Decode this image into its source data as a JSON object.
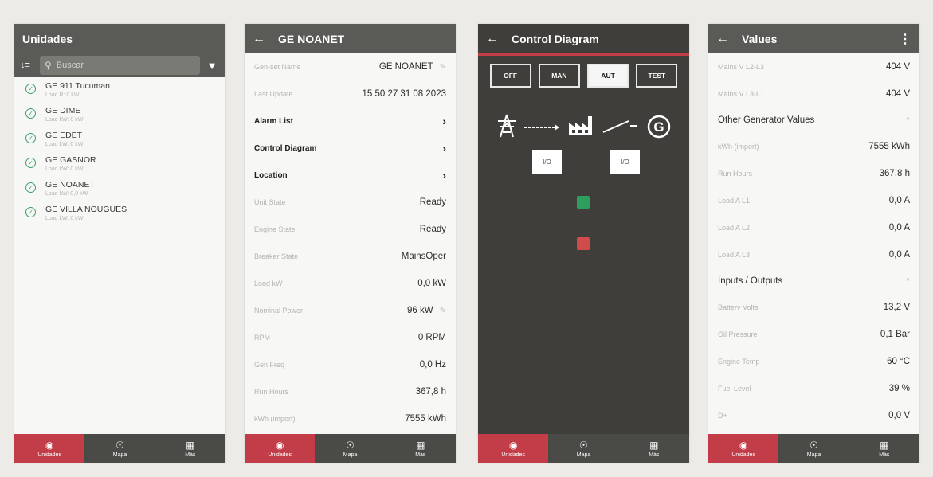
{
  "units_panel": {
    "title": "Unidades",
    "sort_icon": "sort-icon",
    "search_placeholder": "Buscar",
    "items": [
      {
        "name": "GE 911 Tucuman",
        "sub": "Load R: 0 kW"
      },
      {
        "name": "GE DIME",
        "sub": "Load kW: 0 kW"
      },
      {
        "name": "GE EDET",
        "sub": "Load kW: 0 kW"
      },
      {
        "name": "GE GASNOR",
        "sub": "Load kW: 0 kW"
      },
      {
        "name": "GE NOANET",
        "sub": "Load kW: 0,0 kW"
      },
      {
        "name": "GE VILLA NOUGUES",
        "sub": "Load kW: 0 kW"
      }
    ]
  },
  "nav": {
    "units": "Unidades",
    "map": "Mapa",
    "more": "Más"
  },
  "genset_panel": {
    "title": "GE NOANET",
    "genset_name_label": "Gen-set Name",
    "genset_name": "GE NOANET",
    "last_update_label": "Last Update",
    "last_update": "15 50 27 31 08 2023",
    "alarm_list": "Alarm List",
    "control_diagram": "Control Diagram",
    "location": "Location",
    "fields": [
      {
        "label": "Unit State",
        "value": "Ready"
      },
      {
        "label": "Engine State",
        "value": "Ready"
      },
      {
        "label": "Breaker State",
        "value": "MainsOper"
      },
      {
        "label": "Load kW",
        "value": "0,0 kW"
      }
    ],
    "nominal_power_label": "Nominal Power",
    "nominal_power": "96 kW",
    "fields2": [
      {
        "label": "RPM",
        "value": "0 RPM"
      },
      {
        "label": "Gen Freq",
        "value": "0,0 Hz"
      },
      {
        "label": "Run Hours",
        "value": "367,8 h"
      },
      {
        "label": "kWh (import)",
        "value": "7555 kWh"
      }
    ]
  },
  "control_panel": {
    "title": "Control Diagram",
    "modes": [
      "OFF",
      "MAN",
      "AUT",
      "TEST"
    ],
    "active_mode": "AUT",
    "io_label": "I/O",
    "generator_glyph": "G",
    "icons": [
      "power-tower-icon",
      "factory-icon",
      "generator-icon"
    ],
    "status_colors": {
      "on": "#2e9e5e",
      "off": "#d24b4b"
    }
  },
  "values_panel": {
    "title": "Values",
    "rows1": [
      {
        "label": "Mains V L2-L3",
        "value": "404 V"
      },
      {
        "label": "Mains V L3-L1",
        "value": "404 V"
      }
    ],
    "section1": "Other Generator Values",
    "rows2": [
      {
        "label": "kWh (import)",
        "value": "7555 kWh"
      },
      {
        "label": "Run Hours",
        "value": "367,8 h"
      },
      {
        "label": "Load A L1",
        "value": "0,0 A"
      },
      {
        "label": "Load A L2",
        "value": "0,0 A"
      },
      {
        "label": "Load A L3",
        "value": "0,0 A"
      }
    ],
    "section2": "Inputs / Outputs",
    "rows3": [
      {
        "label": "Battery Volts",
        "value": "13,2 V"
      },
      {
        "label": "Oil Pressure",
        "value": "0,1 Bar"
      },
      {
        "label": "Engine Temp",
        "value": "60 °C"
      },
      {
        "label": "Fuel Level",
        "value": "39 %"
      },
      {
        "label": "D+",
        "value": "0,0 V"
      }
    ]
  },
  "colors": {
    "header": "#5a5a56",
    "accent": "#c23d47",
    "diagram_bg": "#3f3e3a"
  }
}
